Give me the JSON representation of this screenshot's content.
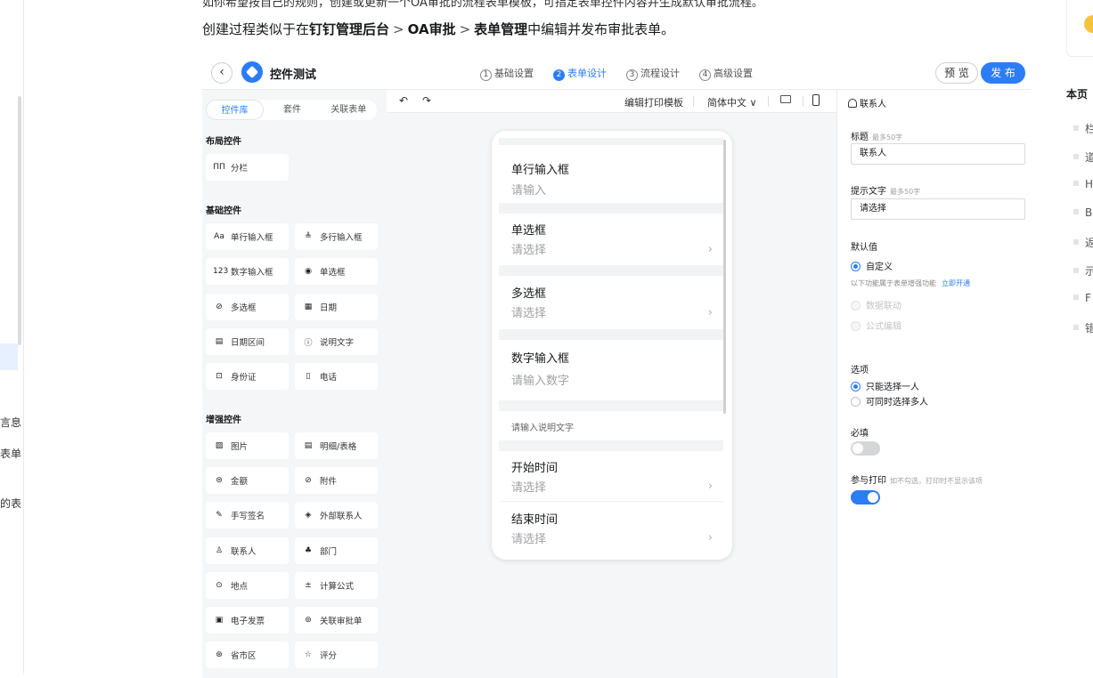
{
  "left_nav": {
    "fragments": [
      "言息",
      "表单",
      "的表"
    ]
  },
  "doc": {
    "top_text": "如你希望按自己的规则，创建或更新一个OA审批的流程表单模板，可指定表单控件内容并生成默认审批流程。",
    "line_prefix": "创建过程类似于在",
    "crumb1": "钉钉管理后台",
    "crumb_sep": ">",
    "crumb2": "OA审批",
    "crumb3": "表单管理",
    "line_suffix": "中编辑并发布审批表单。"
  },
  "editor": {
    "back_icon": "‹",
    "title": "控件测试",
    "steps": [
      {
        "num": "1",
        "label": "基础设置",
        "active": false
      },
      {
        "num": "2",
        "label": "表单设计",
        "active": true
      },
      {
        "num": "3",
        "label": "流程设计",
        "active": false
      },
      {
        "num": "4",
        "label": "高级设置",
        "active": false
      }
    ],
    "preview_label": "预 览",
    "publish_label": "发 布",
    "accent_color": "#2c7cf6"
  },
  "library": {
    "tabs": [
      "控件库",
      "套件",
      "关联表单"
    ],
    "sections": {
      "layout": "布局控件",
      "basic": "基础控件",
      "enhanced": "增强控件"
    },
    "layout_items": [
      {
        "icon": "ΠΠ",
        "label": "分栏"
      }
    ],
    "basic_items": [
      {
        "icon": "Aa",
        "label": "单行输入框"
      },
      {
        "icon": "≜",
        "label": "多行输入框"
      },
      {
        "icon": "123",
        "label": "数字输入框"
      },
      {
        "icon": "◉",
        "label": "单选框"
      },
      {
        "icon": "⊘",
        "label": "多选框"
      },
      {
        "icon": "▦",
        "label": "日期"
      },
      {
        "icon": "▤",
        "label": "日期区间"
      },
      {
        "icon": "ⓘ",
        "label": "说明文字"
      },
      {
        "icon": "⊡",
        "label": "身份证"
      },
      {
        "icon": "▯",
        "label": "电话"
      }
    ],
    "enhanced_items": [
      {
        "icon": "▨",
        "label": "图片"
      },
      {
        "icon": "▤",
        "label": "明细/表格"
      },
      {
        "icon": "⊜",
        "label": "金额"
      },
      {
        "icon": "⊘",
        "label": "附件"
      },
      {
        "icon": "✎",
        "label": "手写签名"
      },
      {
        "icon": "◈",
        "label": "外部联系人"
      },
      {
        "icon": "♙",
        "label": "联系人"
      },
      {
        "icon": "♣",
        "label": "部门"
      },
      {
        "icon": "⊙",
        "label": "地点"
      },
      {
        "icon": "±",
        "label": "计算公式"
      },
      {
        "icon": "▣",
        "label": "电子发票"
      },
      {
        "icon": "⊚",
        "label": "关联审批单"
      },
      {
        "icon": "⊛",
        "label": "省市区"
      },
      {
        "icon": "☆",
        "label": "评分"
      }
    ]
  },
  "canvas": {
    "undo_icon": "↶",
    "redo_icon": "↷",
    "print_template": "编辑打印模板",
    "language": "简体中文 ∨",
    "fields": [
      {
        "label": "单行输入框",
        "placeholder": "请输入",
        "arrow": false
      },
      {
        "label": "单选框",
        "placeholder": "请选择",
        "arrow": true
      },
      {
        "label": "多选框",
        "placeholder": "请选择",
        "arrow": true
      },
      {
        "label": "数字输入框",
        "placeholder": "请输入数字",
        "arrow": false
      }
    ],
    "description_placeholder": "请输入说明文字",
    "time_fields": [
      {
        "label": "开始时间",
        "placeholder": "请选择"
      },
      {
        "label": "结束时间",
        "placeholder": "请选择"
      }
    ],
    "arrow_glyph": "›"
  },
  "properties": {
    "header": "联系人",
    "title_label": "标题",
    "title_hint": "最多50字",
    "title_value": "联系人",
    "tip_label": "提示文字",
    "tip_hint": "最多50字",
    "tip_value": "请选择",
    "default_label": "默认值",
    "default_options": [
      {
        "label": "自定义",
        "checked": true,
        "disabled": false
      }
    ],
    "enhance_note": "以下功能属于表单增强功能",
    "enhance_link": "立即开通",
    "enhanced_options": [
      {
        "label": "数据联动",
        "disabled": true
      },
      {
        "label": "公式编辑",
        "disabled": true
      }
    ],
    "option_label": "选项",
    "choice_options": [
      {
        "label": "只能选择一人",
        "checked": true
      },
      {
        "label": "可同时选择多人",
        "checked": false
      }
    ],
    "required_label": "必填",
    "required_on": false,
    "print_label": "参与打印",
    "print_hint": "如不勾选，打印时不显示该项",
    "print_on": true
  },
  "toc": {
    "title": "本页",
    "items": [
      "栏",
      "道",
      "H",
      "B",
      "返",
      "示",
      "F",
      "错"
    ]
  }
}
